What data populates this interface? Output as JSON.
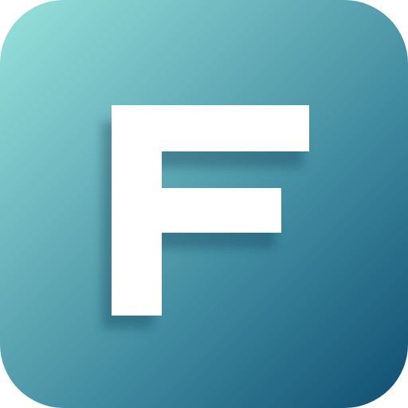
{
  "app_icon": {
    "letter": "F",
    "colors": {
      "gradient_start": "#98e2dd",
      "gradient_end": "#0f4e72",
      "letter_color": "#ffffff",
      "shadow_color": "#0b3a52"
    }
  }
}
